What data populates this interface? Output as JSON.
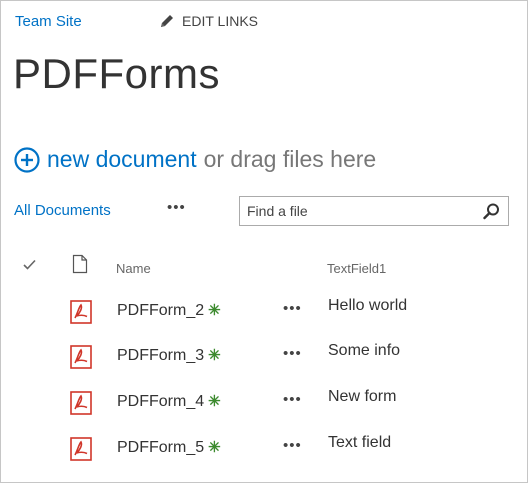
{
  "header": {
    "site_link": "Team Site",
    "edit_links": "EDIT LINKS",
    "page_title": "PDFForms"
  },
  "toolbar": {
    "new_document": "new document",
    "drag_text": "or drag files here",
    "view_name": "All Documents",
    "more_label": "•••",
    "search_placeholder": "Find a file"
  },
  "columns": {
    "name": "Name",
    "textfield": "TextField1"
  },
  "rows": [
    {
      "name": "PDFForm_2",
      "badge": "✳",
      "more": "•••",
      "textfield": "Hello world"
    },
    {
      "name": "PDFForm_3",
      "badge": "✳",
      "more": "•••",
      "textfield": "Some info"
    },
    {
      "name": "PDFForm_4",
      "badge": "✳",
      "more": "•••",
      "textfield": "New form"
    },
    {
      "name": "PDFForm_5",
      "badge": "✳",
      "more": "•••",
      "textfield": "Text field"
    }
  ],
  "colors": {
    "link": "#0072c6",
    "new_badge": "#3c8a2e",
    "pdf_icon": "#d0362a"
  },
  "icons": [
    "pencil-icon",
    "plus-circle-icon",
    "search-icon",
    "check-icon",
    "document-icon",
    "pdf-icon"
  ]
}
